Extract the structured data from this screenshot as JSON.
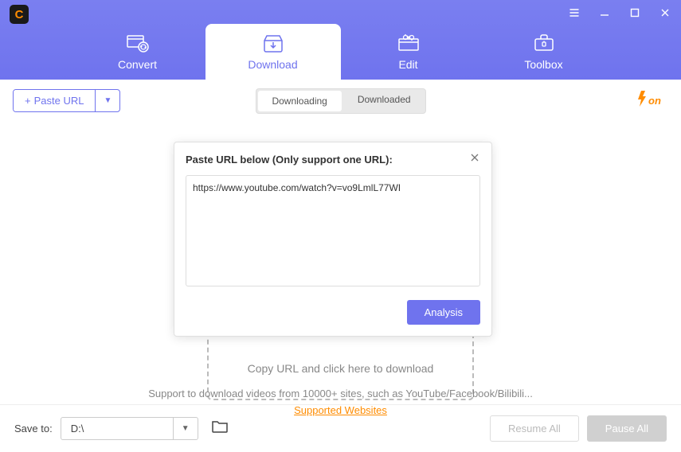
{
  "app": {
    "icon_letter": "C"
  },
  "tabs": {
    "convert": "Convert",
    "download": "Download",
    "edit": "Edit",
    "toolbox": "Toolbox"
  },
  "toolbar": {
    "paste_url": "Paste URL",
    "seg_downloading": "Downloading",
    "seg_downloaded": "Downloaded",
    "fon": "4on"
  },
  "dropzone": {
    "hint": "Copy URL and click here to download"
  },
  "support": {
    "text": "Support to download videos from 10000+ sites, such as YouTube/Facebook/Bilibili...",
    "link": "Supported Websites"
  },
  "modal": {
    "title": "Paste URL below (Only support one URL):",
    "url_value": "https://www.youtube.com/watch?v=vo9LmlL77WI",
    "analysis": "Analysis"
  },
  "footer": {
    "save_to_label": "Save to:",
    "save_path": "D:\\",
    "resume_all": "Resume All",
    "pause_all": "Pause All"
  }
}
